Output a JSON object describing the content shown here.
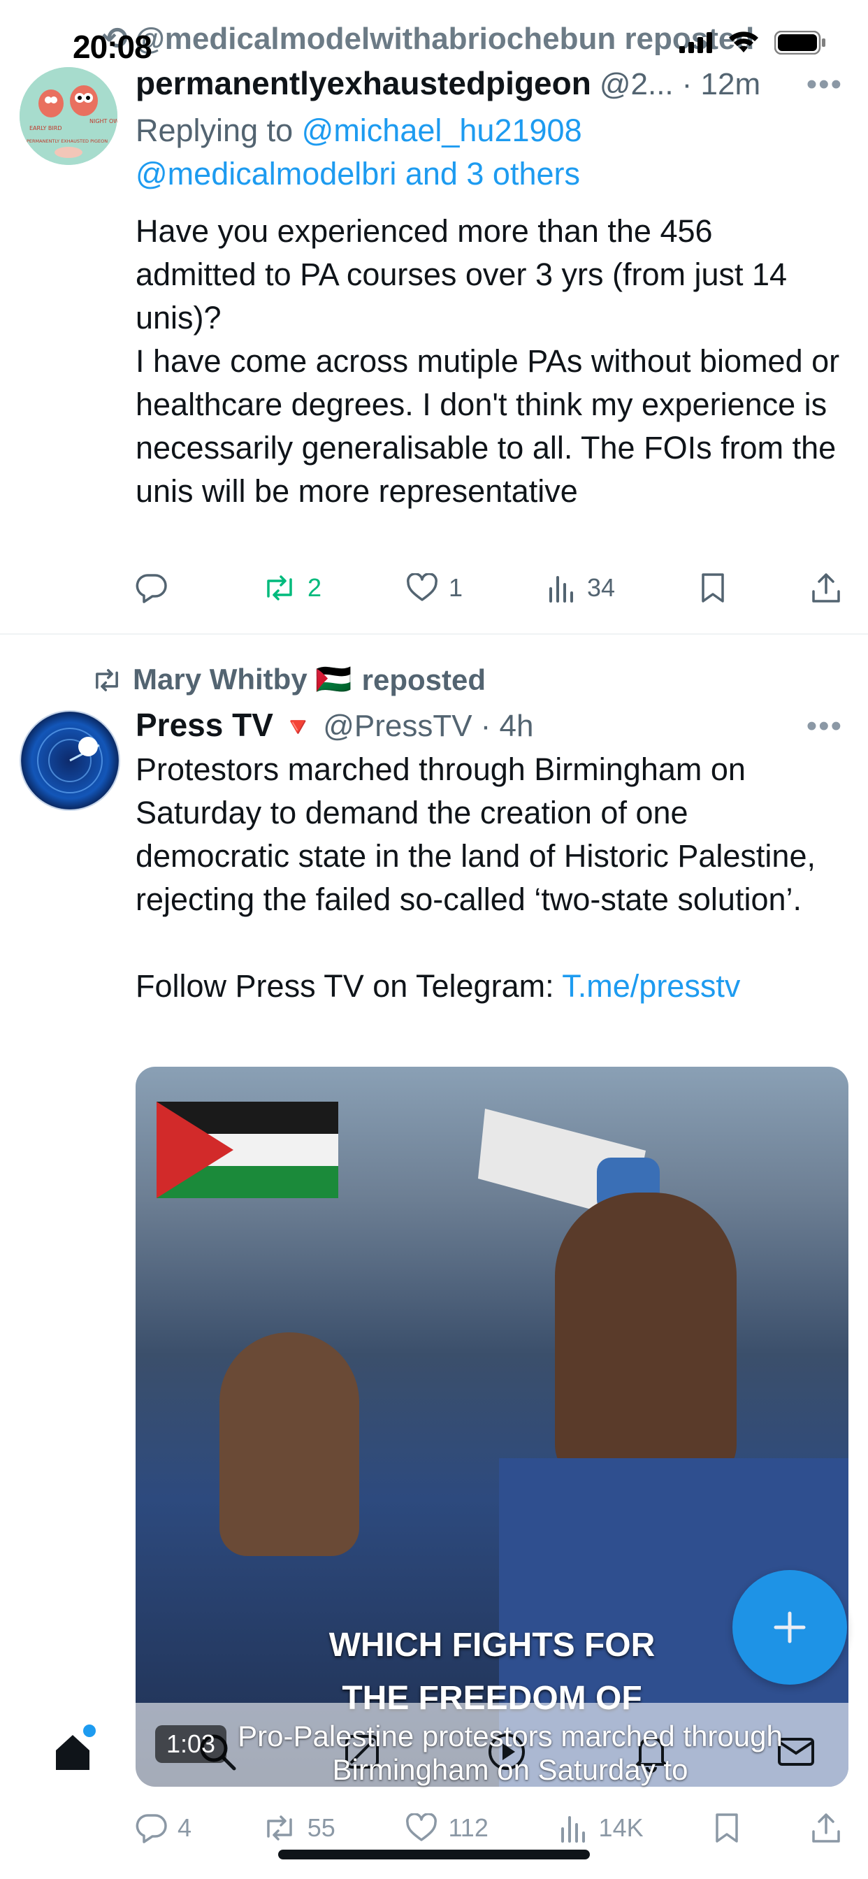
{
  "status": {
    "time": "20:08"
  },
  "tweet1": {
    "repost_text": "@medicalmodelwithabriochebun reposted",
    "name": "permanentlyexhaustedpigeon",
    "handle": "@2...",
    "time": "· 12m",
    "replying_prefix": "Replying to ",
    "replying_user": "@michael_hu21908",
    "replying_others": "@medicalmodelbri and 3 others",
    "avatar_text": {
      "a": "EARLY BIRD",
      "b": "NIGHT OWL",
      "c": "PERMANENTLY EXHAUSTED PIGEON"
    },
    "paragraphs": [
      "Have you experienced more than the 456 admitted to PA courses over 3 yrs (from just 14 unis)?",
      "I have come across mutiple PAs without biomed or healthcare degrees. I don't think my experience is necessarily generalisable to all. The FOIs from the unis will be more representative"
    ],
    "actions": {
      "replies": "",
      "reposts": "2",
      "likes": "1",
      "views": "34"
    }
  },
  "tweet2": {
    "repost_user": "Mary Whitby 🇵🇸",
    "repost_suffix": "reposted",
    "name": "Press TV",
    "badge": "🔻",
    "handle": "@PressTV",
    "time": "· 4h",
    "paragraphs": [
      "Protestors marched through Birmingham on Saturday to demand the creation of one democratic state in the land of Historic Palestine, rejecting the failed so-called ‘two-state solution’."
    ],
    "follow_prefix": "Follow Press TV on Telegram: ",
    "follow_link": "T.me/presstv",
    "video": {
      "caption_line1": "WHICH FIGHTS FOR",
      "caption_line2": "THE FREEDOM OF",
      "duration": "1:03",
      "title": "Pro-Palestine protestors marched through Birmingham on Saturday to"
    },
    "actions": {
      "replies": "4",
      "reposts": "55",
      "likes": "112",
      "views": "14K"
    }
  },
  "tabs": [
    "home-tab",
    "search-tab",
    "grok-tab",
    "videos-tab",
    "notifications-tab",
    "messages-tab"
  ],
  "colors": {
    "accent": "#1d9bf0",
    "repost_green": "#00ba7c",
    "muted": "#536471"
  }
}
